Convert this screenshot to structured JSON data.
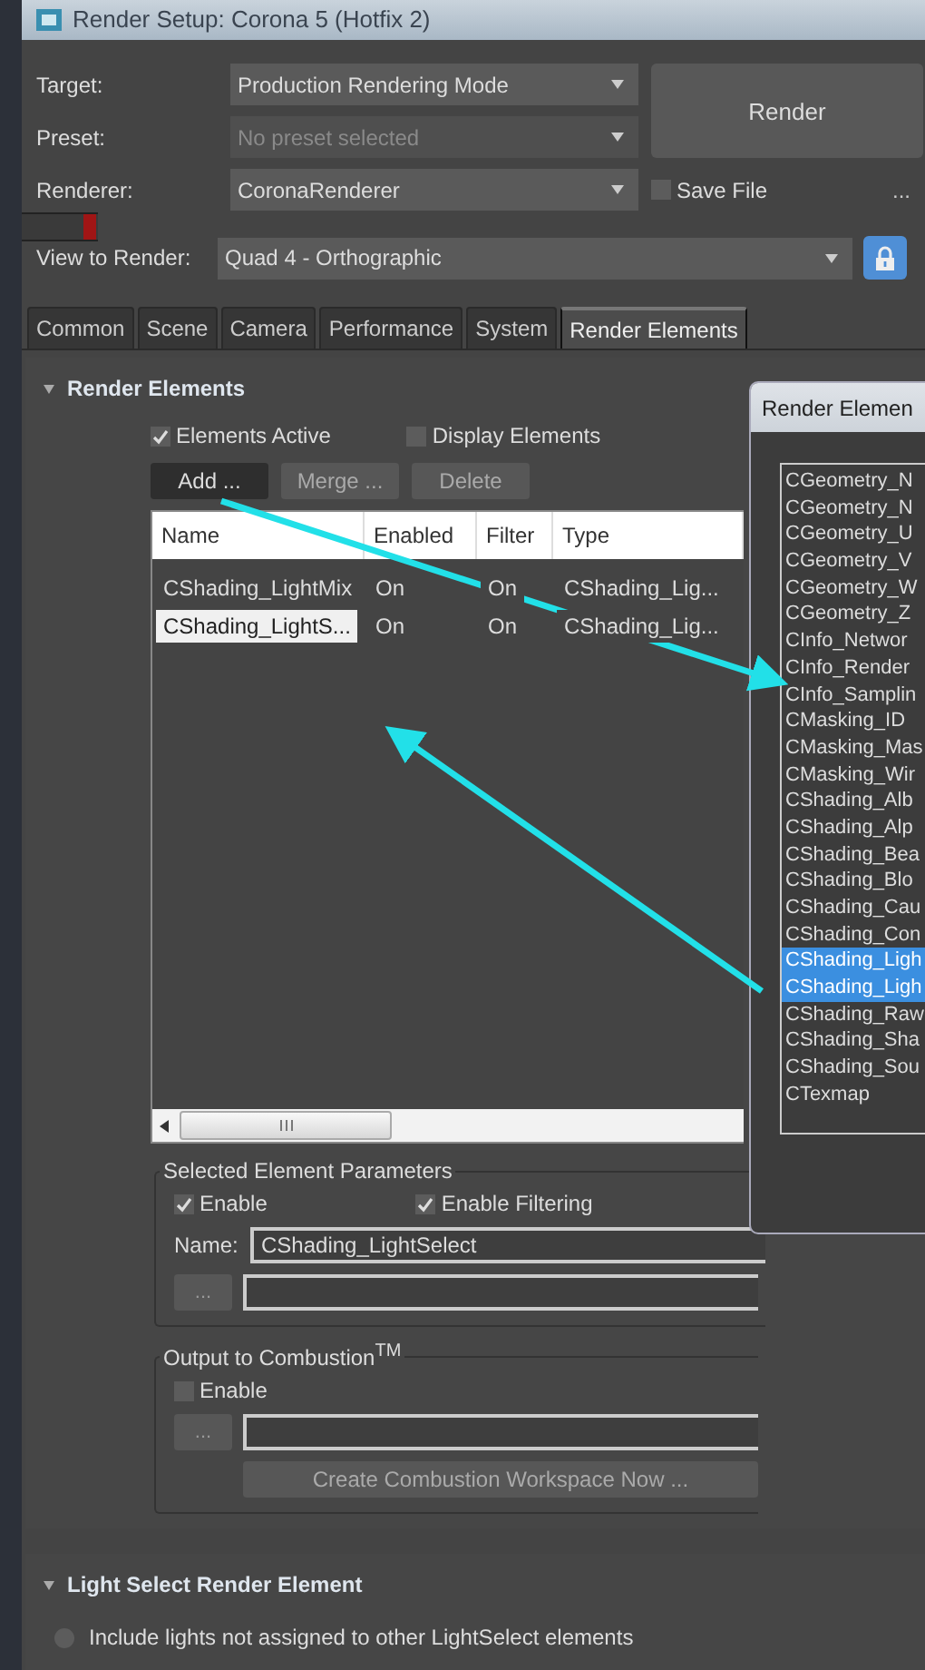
{
  "window": {
    "title": "Render Setup: Corona 5 (Hotfix 2)"
  },
  "settings": [
    {
      "label": "Target:",
      "value": "Production Rendering Mode",
      "disabled": false
    },
    {
      "label": "Preset:",
      "value": "No preset selected",
      "disabled": true
    },
    {
      "label": "Renderer:",
      "value": "CoronaRenderer",
      "disabled": false
    }
  ],
  "render_button": "Render",
  "save_file": {
    "label": "Save File",
    "checked": false
  },
  "more_button": "...",
  "view": {
    "label": "View to Render:",
    "value": "Quad 4 - Orthographic",
    "locked": true
  },
  "tabs": [
    {
      "label": "Common",
      "selected": false
    },
    {
      "label": "Scene",
      "selected": false
    },
    {
      "label": "Camera",
      "selected": false
    },
    {
      "label": "Performance",
      "selected": false
    },
    {
      "label": "System",
      "selected": false
    },
    {
      "label": "Render Elements",
      "selected": true
    }
  ],
  "render_elements": {
    "title": "Render Elements",
    "expanded": true,
    "options": [
      {
        "label": "Elements Active",
        "checked": true
      },
      {
        "label": "Display Elements",
        "checked": false
      }
    ],
    "buttons": [
      {
        "label": "Add ...",
        "selected": true
      },
      {
        "label": "Merge ...",
        "selected": false
      },
      {
        "label": "Delete",
        "selected": false
      }
    ],
    "table": {
      "columns": [
        "Name",
        "Enabled",
        "Filter",
        "Type"
      ],
      "rows": [
        {
          "cells": [
            "CShading_LightMix",
            "On",
            "On",
            "CShading_Lig..."
          ],
          "selected": false
        },
        {
          "cells": [
            "CShading_LightS...",
            "On",
            "On",
            "CShading_Lig..."
          ],
          "selected": true
        }
      ]
    }
  },
  "selected_params": {
    "title": "Selected Element Parameters",
    "enable": {
      "label": "Enable",
      "checked": true
    },
    "filtering": {
      "label": "Enable Filtering",
      "checked": true
    },
    "name_label": "Name:",
    "name_value": "CShading_LightSelect",
    "browse_button": "..."
  },
  "combustion": {
    "title": "Output to Combustion$^{TM}$",
    "enable": {
      "label": "Enable",
      "checked": false
    },
    "browse_button": "...",
    "create_button": "Create Combustion Workspace Now ..."
  },
  "light_select": {
    "title": "Light Select Render Element",
    "expanded": true,
    "option": {
      "label": "Include lights not assigned to other LightSelect elements",
      "selected": false
    }
  },
  "picker": {
    "title": "Render Elemen",
    "items": [
      {
        "label": "CGeometry_N",
        "selected": false
      },
      {
        "label": "CGeometry_N",
        "selected": false
      },
      {
        "label": "CGeometry_U",
        "selected": false
      },
      {
        "label": "CGeometry_V",
        "selected": false
      },
      {
        "label": "CGeometry_W",
        "selected": false
      },
      {
        "label": "CGeometry_Z",
        "selected": false
      },
      {
        "label": "CInfo_Networ",
        "selected": false
      },
      {
        "label": "CInfo_Render",
        "selected": false
      },
      {
        "label": "CInfo_Samplin",
        "selected": false
      },
      {
        "label": "CMasking_ID",
        "selected": false
      },
      {
        "label": "CMasking_Mas",
        "selected": false
      },
      {
        "label": "CMasking_Wir",
        "selected": false
      },
      {
        "label": "CShading_Alb",
        "selected": false
      },
      {
        "label": "CShading_Alp",
        "selected": false
      },
      {
        "label": "CShading_Bea",
        "selected": false
      },
      {
        "label": "CShading_Blo",
        "selected": false
      },
      {
        "label": "CShading_Cau",
        "selected": false
      },
      {
        "label": "CShading_Con",
        "selected": false
      },
      {
        "label": "CShading_Ligh",
        "selected": true
      },
      {
        "label": "CShading_Ligh",
        "selected": true
      },
      {
        "label": "CShading_Raw",
        "selected": false
      },
      {
        "label": "CShading_Sha",
        "selected": false
      },
      {
        "label": "CShading_Sou",
        "selected": false
      },
      {
        "label": "CTexmap",
        "selected": false
      }
    ]
  }
}
